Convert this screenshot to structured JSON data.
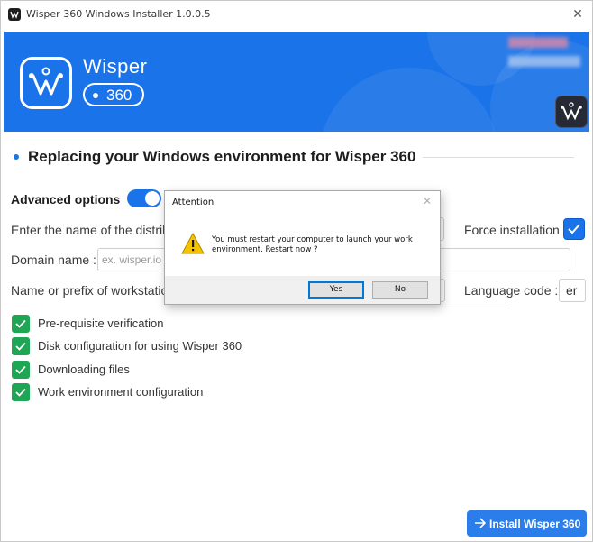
{
  "window": {
    "title": "Wisper 360 Windows Installer 1.0.0.5",
    "close_symbol": "✕"
  },
  "banner": {
    "brand_name": "Wisper",
    "brand_version": "360",
    "logo_icon": "wisper-w-logo",
    "accent_color": "#1a73e8"
  },
  "section": {
    "title": "Replacing your Windows environment for Wisper 360"
  },
  "form": {
    "advanced_label": "Advanced options",
    "advanced_enabled": true,
    "distrib_label": "Enter the name of the distrib",
    "force_label": "Force installation",
    "force_checked": true,
    "domain_label": "Domain name :",
    "domain_placeholder": "ex. wisper.io",
    "workstation_label": "Name or prefix of workstatio",
    "language_label": "Language code :",
    "language_value": "er"
  },
  "steps": [
    {
      "label": "Pre-requisite verification",
      "done": true
    },
    {
      "label": "Disk configuration for using Wisper 360",
      "done": true
    },
    {
      "label": "Downloading files",
      "done": true
    },
    {
      "label": "Work environment configuration",
      "done": true
    }
  ],
  "install_button": {
    "label": "Install Wisper 360",
    "icon": "arrow-right-icon"
  },
  "dialog": {
    "title": "Attention",
    "close_symbol": "✕",
    "message": "You must restart your computer to launch your work environment. Restart now ?",
    "icon": "warning-icon",
    "yes_label": "Yes",
    "no_label": "No"
  }
}
